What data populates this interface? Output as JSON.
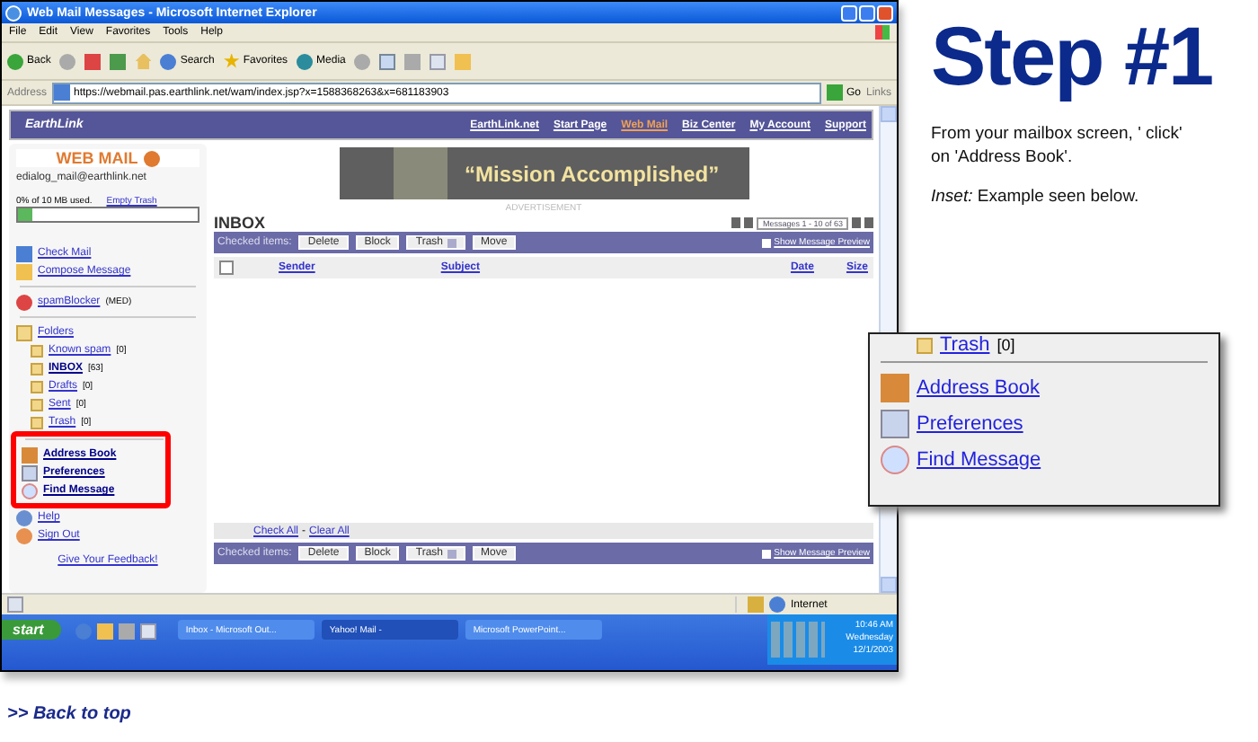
{
  "browser": {
    "title": "Web Mail Messages - Microsoft Internet Explorer",
    "menu": [
      "File",
      "Edit",
      "View",
      "Favorites",
      "Tools",
      "Help"
    ],
    "toolbar": [
      "Back",
      "Search",
      "Favorites",
      "Media"
    ],
    "address_label": "Address",
    "url": "https://webmail.pas.earthlink.net/wam/index.jsp?x=1588368263&x=681183903",
    "go": "Go",
    "links": "Links"
  },
  "site": {
    "logo": "EarthLink",
    "nav": [
      {
        "label": "EarthLink.net",
        "selected": false
      },
      {
        "label": "Start Page",
        "selected": false
      },
      {
        "label": "Web Mail",
        "selected": true
      },
      {
        "label": "Biz Center",
        "selected": false
      },
      {
        "label": "My Account",
        "selected": false
      },
      {
        "label": "Support",
        "selected": false
      }
    ]
  },
  "sidebar": {
    "brand": "WEB MAIL",
    "email": "edialog_mail@earthlink.net",
    "usage": "0% of 10 MB used.",
    "empty_trash": "Empty Trash",
    "level": 0.08,
    "actions": [
      "Check Mail",
      "Compose Message"
    ],
    "spam": {
      "label": "spamBlocker",
      "note": "(MED)"
    },
    "folders": {
      "label": "Folders",
      "children": [
        {
          "name": "Known spam",
          "count": "[0]",
          "selected": false
        },
        {
          "name": "INBOX",
          "count": "[63]",
          "selected": true
        },
        {
          "name": "Drafts",
          "count": "[0]",
          "selected": false
        },
        {
          "name": "Sent",
          "count": "[0]",
          "selected": false
        },
        {
          "name": "Trash",
          "count": "[0]",
          "selected": false
        }
      ]
    },
    "tools": [
      "Address Book",
      "Preferences",
      "Find Message",
      "Help",
      "Sign Out"
    ],
    "feedback": "Give Your Feedback!"
  },
  "ad": {
    "text": "“Mission Accomplished”",
    "caption": "ADVERTISEMENT"
  },
  "inbox": {
    "title": "INBOX",
    "select_all": {
      "checked": false
    },
    "pager": "Messages 1 - 10 of 63",
    "columns": [
      "Sender",
      "Subject",
      "Date",
      "Size"
    ],
    "check_all": "Check All",
    "separator": "-",
    "clear_all": "Clear All",
    "toolbars": [
      {
        "label": "Checked items:",
        "buttons": [
          "Delete",
          "Block"
        ],
        "folder": "Trash",
        "move": "Move",
        "preview": "Show Message Preview"
      },
      {
        "label": "Checked items:",
        "buttons": [
          "Delete",
          "Block"
        ],
        "folder": "Trash",
        "move": "Move",
        "preview": "Show Message Preview"
      }
    ]
  },
  "status": {
    "zone": "Internet"
  },
  "taskbar": {
    "start": "start",
    "tasks": [
      {
        "label": "Inbox - Microsoft Out...",
        "selected": false
      },
      {
        "label": "Yahoo! Mail -",
        "selected": true
      },
      {
        "label": "Microsoft PowerPoint...",
        "selected": false
      }
    ],
    "clock": [
      "10:46 AM",
      "Wednesday",
      "12/1/2003"
    ]
  },
  "step": {
    "title": "Step #1",
    "instruction": "From your mailbox screen, ' click' on 'Address Book'.",
    "note": "*Inset:* Example seen below."
  },
  "inset": {
    "folder": {
      "name": "Trash",
      "count": "[0]"
    },
    "links": [
      "Address Book",
      "Preferences",
      "Find Message"
    ]
  },
  "back_link": ">> Back to top"
}
